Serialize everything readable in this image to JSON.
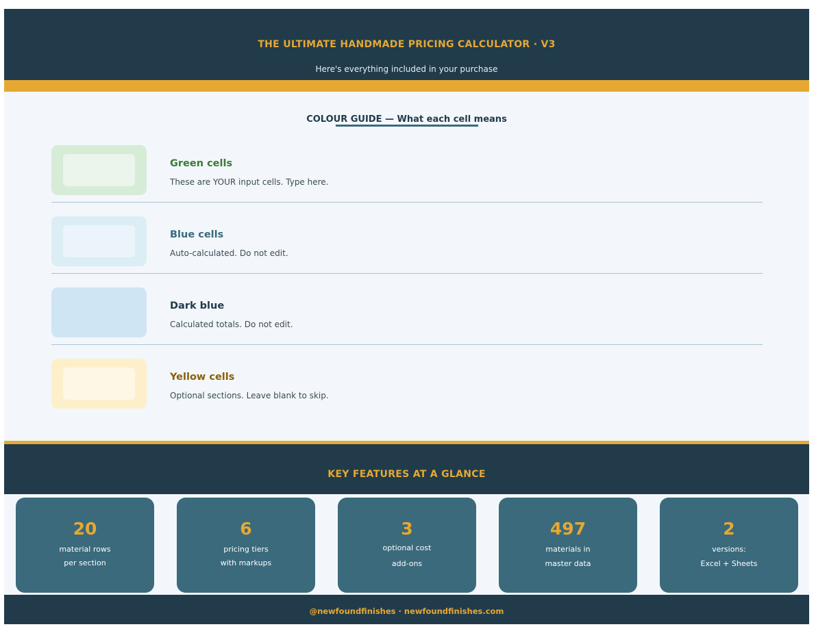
{
  "header": {
    "title": "THE ULTIMATE HANDMADE PRICING CALCULATOR  ·  V3",
    "subtitle": "Here's everything included in your purchase"
  },
  "colour_guide": {
    "title": "COLOUR GUIDE  —  What each cell means",
    "items": [
      {
        "name": "Green cells",
        "description": "These are YOUR input cells. Type here."
      },
      {
        "name": "Blue cells",
        "description": "Auto-calculated. Do not edit."
      },
      {
        "name": "Dark blue",
        "description": "Calculated totals. Do not edit."
      },
      {
        "name": "Yellow cells",
        "description": "Optional sections. Leave blank to skip."
      }
    ]
  },
  "features": {
    "title": "KEY FEATURES AT A GLANCE",
    "cards": [
      {
        "value": "20",
        "line1": "material rows",
        "line2": "per section"
      },
      {
        "value": "6",
        "line1": "pricing tiers",
        "line2": "with markups"
      },
      {
        "value": "3",
        "line1": "optional cost",
        "line2": "add-ons"
      },
      {
        "value": "497",
        "line1": "materials in",
        "line2": "master data"
      },
      {
        "value": "2",
        "line1": "versions:",
        "line2": "Excel + Sheets"
      }
    ]
  },
  "footer": {
    "text": "@newfoundfinishes  ·  newfoundfinishes.com"
  },
  "colors": {
    "navy": "#213b4a",
    "gold": "#e6a833",
    "teal": "#3a6a7c",
    "background": "#f3f7fb"
  }
}
